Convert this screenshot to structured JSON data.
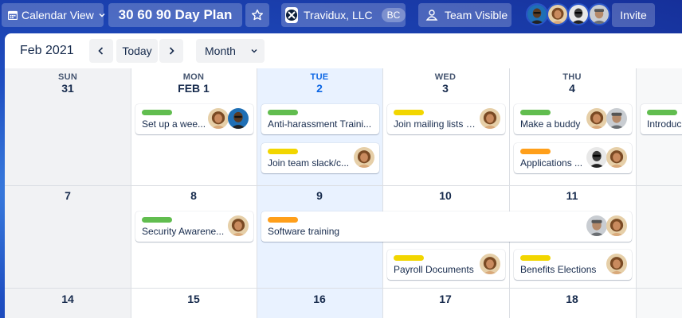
{
  "header": {
    "view_switcher_label": "Calendar View",
    "board_title": "30 60 90 Day Plan",
    "workspace": {
      "name": "Travidux, LLC",
      "badge": "BC"
    },
    "visibility_label": "Team Visible",
    "invite_label": "Invite",
    "members": [
      "member-1",
      "member-2",
      "member-3",
      "member-4"
    ]
  },
  "toolbar": {
    "month_label": "Feb 2021",
    "today_label": "Today",
    "range_label": "Month"
  },
  "calendar": {
    "day_names": [
      "SUN",
      "MON",
      "TUE",
      "WED",
      "THU"
    ],
    "week1_dates": [
      "31",
      "FEB 1",
      "2",
      "3",
      "4"
    ],
    "week2_dates": [
      "7",
      "8",
      "9",
      "10",
      "11"
    ],
    "week3_dates": [
      "14",
      "15",
      "16",
      "17",
      "18"
    ]
  },
  "cards": {
    "setup_week": "Set up a wee...",
    "anti_harassment": "Anti-harassment Traini...",
    "mailing_lists": "Join mailing lists a...",
    "make_buddy": "Make a buddy",
    "introduce": "Introduc",
    "team_slack": "Join team slack/c...",
    "applications": "Applications ...",
    "security_awareness": "Security Awarene...",
    "software_training": "Software training",
    "payroll_documents": "Payroll Documents",
    "benefits_elections": "Benefits Elections"
  },
  "colors": {
    "green": "#61bd4f",
    "yellow": "#f2d600",
    "orange": "#ff9f1a",
    "accent": "#0c66e4"
  }
}
